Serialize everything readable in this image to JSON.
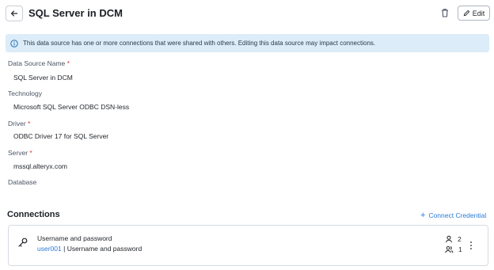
{
  "header": {
    "title": "SQL Server in DCM",
    "edit_label": "Edit"
  },
  "info_banner": {
    "text": "This data source has one or more connections that were shared with others. Editing this data source may impact connections."
  },
  "fields": {
    "data_source_name": {
      "label": "Data Source Name",
      "value": "SQL Server in DCM"
    },
    "technology": {
      "label": "Technology",
      "value": "Microsoft SQL Server ODBC DSN-less"
    },
    "driver": {
      "label": "Driver",
      "value": "ODBC Driver 17 for SQL Server"
    },
    "server": {
      "label": "Server",
      "value": "mssql.alteryx.com"
    },
    "database": {
      "label": "Database",
      "value": ""
    }
  },
  "connections": {
    "title": "Connections",
    "connect_credential_label": "Connect Credential",
    "items": [
      {
        "name": "Username and password",
        "user": "user001",
        "separator": "|",
        "auth": "Username and password",
        "user_count": "2",
        "group_count": "1"
      }
    ]
  },
  "colors": {
    "info_bg": "#dcecf8",
    "link": "#2a7bd6",
    "required": "#d33"
  }
}
